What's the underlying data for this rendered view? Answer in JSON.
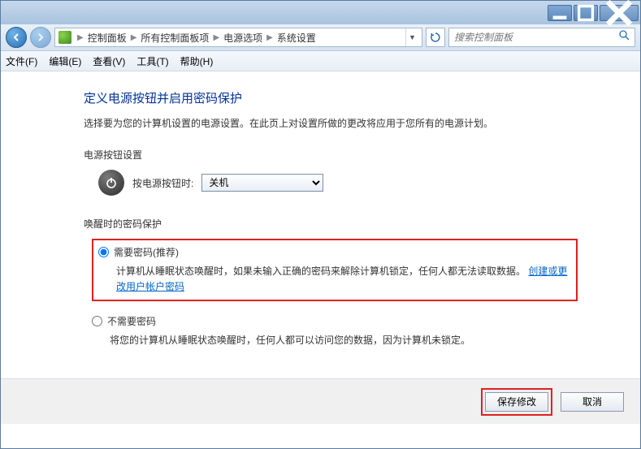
{
  "breadcrumb": {
    "root": "控制面板",
    "allitems": "所有控制面板项",
    "power": "电源选项",
    "syssettings": "系统设置"
  },
  "search": {
    "placeholder": "搜索控制面板"
  },
  "menu": {
    "file": "文件(F)",
    "edit": "编辑(E)",
    "view": "查看(V)",
    "tools": "工具(T)",
    "help": "帮助(H)"
  },
  "page": {
    "title": "定义电源按钮并启用密码保护",
    "desc": "选择要为您的计算机设置的电源设置。在此页上对设置所做的更改将应用于您所有的电源计划。"
  },
  "powerbtn": {
    "section": "电源按钮设置",
    "label": "按电源按钮时:",
    "selected": "关机"
  },
  "wake": {
    "section": "唤醒时的密码保护",
    "opt1_label": "需要密码(推荐)",
    "opt1_desc_a": "计算机从睡眠状态唤醒时，如果未输入正确的密码来解除计算机锁定，任何人都无法读取数据。",
    "opt1_link": "创建或更改用户帐户密码",
    "opt2_label": "不需要密码",
    "opt2_desc": "将您的计算机从睡眠状态唤醒时，任何人都可以访问您的数据，因为计算机未锁定。"
  },
  "buttons": {
    "save": "保存修改",
    "cancel": "取消"
  }
}
